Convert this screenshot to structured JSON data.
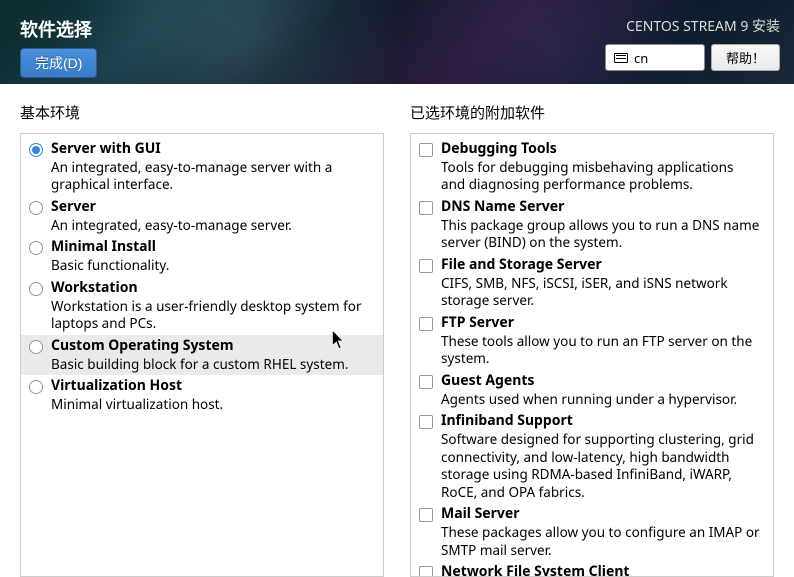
{
  "header": {
    "title": "软件选择",
    "done_label": "完成(D)",
    "product": "CENTOS STREAM 9 安装",
    "lang": "cn",
    "help_label": "帮助！"
  },
  "left": {
    "title": "基本环境",
    "items": [
      {
        "name": "Server with GUI",
        "desc": "An integrated, easy-to-manage server with a graphical interface.",
        "selected": true
      },
      {
        "name": "Server",
        "desc": "An integrated, easy-to-manage server."
      },
      {
        "name": "Minimal Install",
        "desc": "Basic functionality."
      },
      {
        "name": "Workstation",
        "desc": "Workstation is a user-friendly desktop system for laptops and PCs."
      },
      {
        "name": "Custom Operating System",
        "desc": "Basic building block for a custom RHEL system.",
        "hover": true
      },
      {
        "name": "Virtualization Host",
        "desc": "Minimal virtualization host."
      }
    ]
  },
  "right": {
    "title": "已选环境的附加软件",
    "items": [
      {
        "name": "Debugging Tools",
        "desc": "Tools for debugging misbehaving applications and diagnosing performance problems."
      },
      {
        "name": "DNS Name Server",
        "desc": "This package group allows you to run a DNS name server (BIND) on the system."
      },
      {
        "name": "File and Storage Server",
        "desc": "CIFS, SMB, NFS, iSCSI, iSER, and iSNS network storage server."
      },
      {
        "name": "FTP Server",
        "desc": "These tools allow you to run an FTP server on the system."
      },
      {
        "name": "Guest Agents",
        "desc": "Agents used when running under a hypervisor."
      },
      {
        "name": "Infiniband Support",
        "desc": "Software designed for supporting clustering, grid connectivity, and low-latency, high bandwidth storage using RDMA-based InfiniBand, iWARP, RoCE, and OPA fabrics."
      },
      {
        "name": "Mail Server",
        "desc": "These packages allow you to configure an IMAP or SMTP mail server."
      },
      {
        "name": "Network File System Client",
        "desc": ""
      }
    ]
  }
}
